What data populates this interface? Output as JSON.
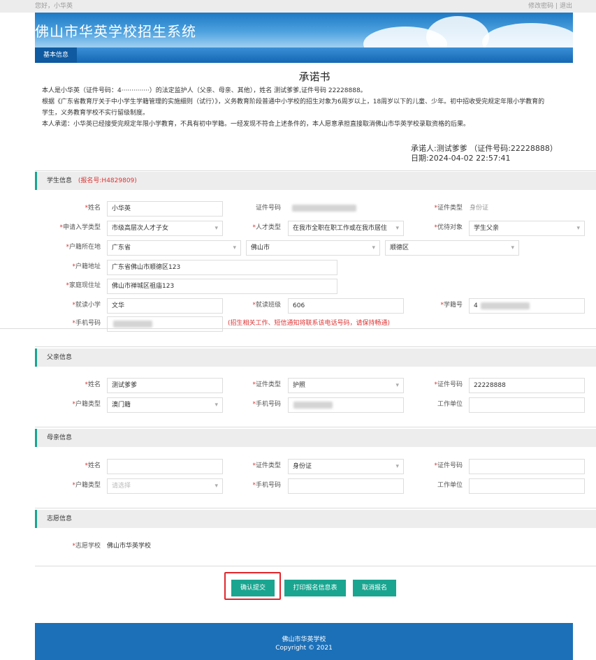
{
  "topbar": {
    "greeting": "您好，小华英",
    "change_pwd": "修改密码",
    "sep": "|",
    "logout": "退出"
  },
  "header": {
    "title": "佛山市华英学校招生系统"
  },
  "nav": {
    "tab": "基本信息"
  },
  "pledge": {
    "title": "承诺书",
    "line1": "本人是小华英（证件号码：4··············）的法定监护人（父亲、母亲、其他），姓名 测试爹爹,证件号码 22228888。",
    "line2": "根据《广东省教育厅关于中小学生学籍管理的实施细则（试行）》，义务教育阶段普通中小学校的招生对象为6周岁以上，18周岁以下的儿童、少年。初中招收受完规定年限小学教育的",
    "line3": "学生，义务教育学校不实行留级制度。",
    "line4": "本人承诺：小华英已经接受完规定年限小学教育，不具有初中学籍。一经发现不符合上述条件的，本人愿意承担直接取消佛山市华英学校录取资格的后果。",
    "signer": "承诺人:测试爹爹 （证件号码:22228888）",
    "date": "日期:2024-04-02 22:57:41"
  },
  "student": {
    "section_title": "学生信息",
    "reg_no": "(报名号:H4829809)",
    "name_label": "姓名",
    "name": "小华英",
    "id_no_label": "证件号码",
    "id_type_label": "证件类型",
    "id_type": "身份证",
    "apply_type_label": "申请入学类型",
    "apply_type": "市级高层次人才子女",
    "talent_type_label": "人才类型",
    "talent_type": "在我市全职在职工作或在我市居住",
    "priority_label": "优待对象",
    "priority": "学生父亲",
    "huji_label": "户籍所在地",
    "province": "广东省",
    "city": "佛山市",
    "district": "顺德区",
    "huji_addr_label": "户籍地址",
    "huji_addr": "广东省佛山市顺德区123",
    "home_addr_label": "家庭现住址",
    "home_addr": "佛山市禅城区祖庙123",
    "primary_label": "就读小学",
    "primary": "文华",
    "class_label": "就读班级",
    "class": "606",
    "student_no_label": "学籍号",
    "student_no": "4",
    "phone_label": "手机号码",
    "phone_note": "(招生相关工作、短信通知将联系该电话号码，请保持畅通)"
  },
  "father": {
    "section_title": "父亲信息",
    "name_label": "姓名",
    "name": "测试爹爹",
    "id_type_label": "证件类型",
    "id_type": "护照",
    "id_no_label": "证件号码",
    "id_no": "22228888",
    "huji_type_label": "户籍类型",
    "huji_type": "澳门籍",
    "phone_label": "手机号码",
    "work_label": "工作单位"
  },
  "mother": {
    "section_title": "母亲信息",
    "name_label": "姓名",
    "id_type_label": "证件类型",
    "id_type": "身份证",
    "id_no_label": "证件号码",
    "huji_type_label": "户籍类型",
    "huji_type_placeholder": "请选择",
    "phone_label": "手机号码",
    "work_label": "工作单位"
  },
  "wish": {
    "section_title": "志愿信息",
    "school_label": "志愿学校",
    "school": "佛山市华英学校"
  },
  "actions": {
    "confirm": "确认提交",
    "print": "打印报名信息表",
    "cancel": "取消报名"
  },
  "footer": {
    "line1": "佛山市华英学校",
    "line2": "Copyright © 2021"
  },
  "colors": {
    "accent": "#1aa590",
    "header_blue": "#1c70b8",
    "required": "#d33333",
    "highlight": "#e0262c"
  }
}
